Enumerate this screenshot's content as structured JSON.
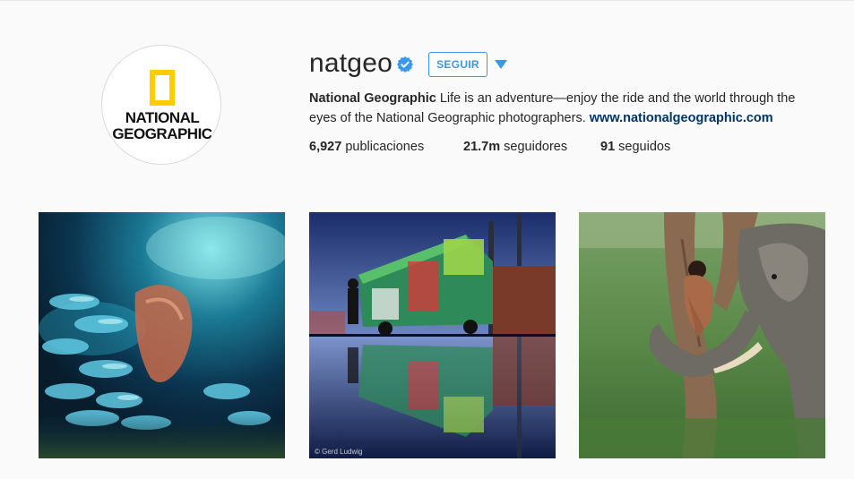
{
  "profile": {
    "username": "natgeo",
    "verified": true,
    "follow_label": "SEGUIR",
    "avatar_text_line1": "NATIONAL",
    "avatar_text_line2": "GEOGRAPHIC",
    "full_name": "National Geographic",
    "bio_text": " Life is an adventure—enjoy the ride and the world through the eyes of the National Geographic photographers. ",
    "website": "www.nationalgeographic.com"
  },
  "stats": {
    "posts_count": "6,927",
    "posts_label": " publicaciones",
    "followers_count": "21.7m",
    "followers_label": " seguidores",
    "following_count": "91",
    "following_label": " seguidos"
  },
  "posts": [
    {
      "subject": "fish-school-underwater",
      "credit": ""
    },
    {
      "subject": "food-truck-reflection",
      "credit": "© Gerd Ludwig"
    },
    {
      "subject": "boy-elephant-tree",
      "credit": ""
    }
  ],
  "colors": {
    "accent": "#3897f0",
    "link": "#003569",
    "background": "#fafafa",
    "natgeo_yellow": "#ffcc00"
  }
}
